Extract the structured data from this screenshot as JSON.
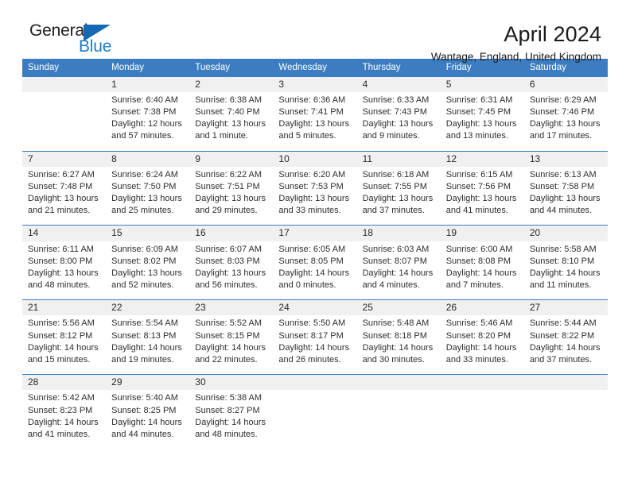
{
  "brand": {
    "name_part1": "General",
    "name_part2": "Blue",
    "accent_color": "#1668b3",
    "blue_text_color": "#1f7cc4"
  },
  "header": {
    "title": "April 2024",
    "subtitle": "Wantage, England, United Kingdom"
  },
  "calendar": {
    "header_bg": "#3b7dc0",
    "date_band_bg": "#f0f0f0",
    "day_names": [
      "Sunday",
      "Monday",
      "Tuesday",
      "Wednesday",
      "Thursday",
      "Friday",
      "Saturday"
    ],
    "weeks": [
      [
        {
          "day": "",
          "lines": []
        },
        {
          "day": "1",
          "lines": [
            "Sunrise: 6:40 AM",
            "Sunset: 7:38 PM",
            "Daylight: 12 hours",
            "and 57 minutes."
          ]
        },
        {
          "day": "2",
          "lines": [
            "Sunrise: 6:38 AM",
            "Sunset: 7:40 PM",
            "Daylight: 13 hours",
            "and 1 minute."
          ]
        },
        {
          "day": "3",
          "lines": [
            "Sunrise: 6:36 AM",
            "Sunset: 7:41 PM",
            "Daylight: 13 hours",
            "and 5 minutes."
          ]
        },
        {
          "day": "4",
          "lines": [
            "Sunrise: 6:33 AM",
            "Sunset: 7:43 PM",
            "Daylight: 13 hours",
            "and 9 minutes."
          ]
        },
        {
          "day": "5",
          "lines": [
            "Sunrise: 6:31 AM",
            "Sunset: 7:45 PM",
            "Daylight: 13 hours",
            "and 13 minutes."
          ]
        },
        {
          "day": "6",
          "lines": [
            "Sunrise: 6:29 AM",
            "Sunset: 7:46 PM",
            "Daylight: 13 hours",
            "and 17 minutes."
          ]
        }
      ],
      [
        {
          "day": "7",
          "lines": [
            "Sunrise: 6:27 AM",
            "Sunset: 7:48 PM",
            "Daylight: 13 hours",
            "and 21 minutes."
          ]
        },
        {
          "day": "8",
          "lines": [
            "Sunrise: 6:24 AM",
            "Sunset: 7:50 PM",
            "Daylight: 13 hours",
            "and 25 minutes."
          ]
        },
        {
          "day": "9",
          "lines": [
            "Sunrise: 6:22 AM",
            "Sunset: 7:51 PM",
            "Daylight: 13 hours",
            "and 29 minutes."
          ]
        },
        {
          "day": "10",
          "lines": [
            "Sunrise: 6:20 AM",
            "Sunset: 7:53 PM",
            "Daylight: 13 hours",
            "and 33 minutes."
          ]
        },
        {
          "day": "11",
          "lines": [
            "Sunrise: 6:18 AM",
            "Sunset: 7:55 PM",
            "Daylight: 13 hours",
            "and 37 minutes."
          ]
        },
        {
          "day": "12",
          "lines": [
            "Sunrise: 6:15 AM",
            "Sunset: 7:56 PM",
            "Daylight: 13 hours",
            "and 41 minutes."
          ]
        },
        {
          "day": "13",
          "lines": [
            "Sunrise: 6:13 AM",
            "Sunset: 7:58 PM",
            "Daylight: 13 hours",
            "and 44 minutes."
          ]
        }
      ],
      [
        {
          "day": "14",
          "lines": [
            "Sunrise: 6:11 AM",
            "Sunset: 8:00 PM",
            "Daylight: 13 hours",
            "and 48 minutes."
          ]
        },
        {
          "day": "15",
          "lines": [
            "Sunrise: 6:09 AM",
            "Sunset: 8:02 PM",
            "Daylight: 13 hours",
            "and 52 minutes."
          ]
        },
        {
          "day": "16",
          "lines": [
            "Sunrise: 6:07 AM",
            "Sunset: 8:03 PM",
            "Daylight: 13 hours",
            "and 56 minutes."
          ]
        },
        {
          "day": "17",
          "lines": [
            "Sunrise: 6:05 AM",
            "Sunset: 8:05 PM",
            "Daylight: 14 hours",
            "and 0 minutes."
          ]
        },
        {
          "day": "18",
          "lines": [
            "Sunrise: 6:03 AM",
            "Sunset: 8:07 PM",
            "Daylight: 14 hours",
            "and 4 minutes."
          ]
        },
        {
          "day": "19",
          "lines": [
            "Sunrise: 6:00 AM",
            "Sunset: 8:08 PM",
            "Daylight: 14 hours",
            "and 7 minutes."
          ]
        },
        {
          "day": "20",
          "lines": [
            "Sunrise: 5:58 AM",
            "Sunset: 8:10 PM",
            "Daylight: 14 hours",
            "and 11 minutes."
          ]
        }
      ],
      [
        {
          "day": "21",
          "lines": [
            "Sunrise: 5:56 AM",
            "Sunset: 8:12 PM",
            "Daylight: 14 hours",
            "and 15 minutes."
          ]
        },
        {
          "day": "22",
          "lines": [
            "Sunrise: 5:54 AM",
            "Sunset: 8:13 PM",
            "Daylight: 14 hours",
            "and 19 minutes."
          ]
        },
        {
          "day": "23",
          "lines": [
            "Sunrise: 5:52 AM",
            "Sunset: 8:15 PM",
            "Daylight: 14 hours",
            "and 22 minutes."
          ]
        },
        {
          "day": "24",
          "lines": [
            "Sunrise: 5:50 AM",
            "Sunset: 8:17 PM",
            "Daylight: 14 hours",
            "and 26 minutes."
          ]
        },
        {
          "day": "25",
          "lines": [
            "Sunrise: 5:48 AM",
            "Sunset: 8:18 PM",
            "Daylight: 14 hours",
            "and 30 minutes."
          ]
        },
        {
          "day": "26",
          "lines": [
            "Sunrise: 5:46 AM",
            "Sunset: 8:20 PM",
            "Daylight: 14 hours",
            "and 33 minutes."
          ]
        },
        {
          "day": "27",
          "lines": [
            "Sunrise: 5:44 AM",
            "Sunset: 8:22 PM",
            "Daylight: 14 hours",
            "and 37 minutes."
          ]
        }
      ],
      [
        {
          "day": "28",
          "lines": [
            "Sunrise: 5:42 AM",
            "Sunset: 8:23 PM",
            "Daylight: 14 hours",
            "and 41 minutes."
          ]
        },
        {
          "day": "29",
          "lines": [
            "Sunrise: 5:40 AM",
            "Sunset: 8:25 PM",
            "Daylight: 14 hours",
            "and 44 minutes."
          ]
        },
        {
          "day": "30",
          "lines": [
            "Sunrise: 5:38 AM",
            "Sunset: 8:27 PM",
            "Daylight: 14 hours",
            "and 48 minutes."
          ]
        },
        {
          "day": "",
          "lines": []
        },
        {
          "day": "",
          "lines": []
        },
        {
          "day": "",
          "lines": []
        },
        {
          "day": "",
          "lines": []
        }
      ]
    ]
  }
}
